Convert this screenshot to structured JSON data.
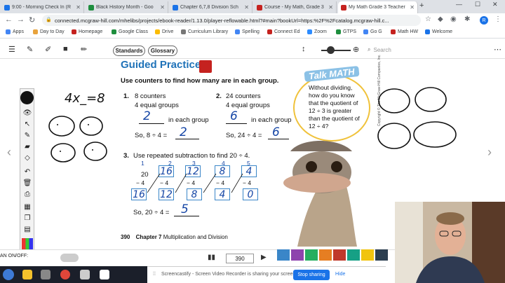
{
  "browser": {
    "tabs": [
      {
        "label": "9:00 - Morning Check In (R",
        "color": "#1a73e8",
        "active": false
      },
      {
        "label": "Black History Month - Goo",
        "color": "#1e8e3e",
        "active": false
      },
      {
        "label": "Chapter 6,7,8 Division Sch",
        "color": "#1a73e8",
        "active": false
      },
      {
        "label": "Course - My Math, Grade 3",
        "color": "#c5221f",
        "active": false
      },
      {
        "label": "My Math Grade 3 Teacher",
        "color": "#c5221f",
        "active": true
      }
    ],
    "url": "connected.mcgraw-hill.com/mhelibs/projects/ebook-reader/1.13.0/player-reflowable.html?#main?bookUrl=https:%2F%2Fcatalog.mcgraw-hill.c...",
    "profile_initial": "R",
    "bookmarks": [
      {
        "label": "Apps",
        "color": "#4285f4"
      },
      {
        "label": "Day to Day",
        "color": "#e8a33d"
      },
      {
        "label": "Homepage",
        "color": "#c5221f"
      },
      {
        "label": "Google Class",
        "color": "#1e8e3e"
      },
      {
        "label": "Drive",
        "color": "#fbbc04"
      },
      {
        "label": "Curriculum Library",
        "color": "#777777"
      },
      {
        "label": "Spelling",
        "color": "#4285f4"
      },
      {
        "label": "Connect Ed",
        "color": "#c5221f"
      },
      {
        "label": "Zoom",
        "color": "#2d8cff"
      },
      {
        "label": "GTPS",
        "color": "#1e8e3e"
      },
      {
        "label": "Go G",
        "color": "#4285f4"
      },
      {
        "label": "Math HW",
        "color": "#c5221f"
      },
      {
        "label": "Welcome",
        "color": "#1a73e8"
      }
    ]
  },
  "reader": {
    "standards_label": "Standards",
    "glossary_label": "Glossary",
    "search_placeholder": "Search",
    "page_number": "390",
    "onoff_label": "AN        ON/OFF:"
  },
  "page": {
    "heading": "Guided Practice",
    "instruction": "Use counters to find how many are in each group.",
    "problem1": {
      "number": "1.",
      "line1": "8 counters",
      "line2": "4 equal groups",
      "answer": "2",
      "suffix": "in each group",
      "eq_prefix": "So, 8 ÷ 4 =",
      "eq_answer": "2"
    },
    "problem2": {
      "number": "2.",
      "line1": "24 counters",
      "line2": "4 equal groups",
      "answer": "6",
      "suffix": "in each group",
      "eq_prefix": "So, 24 ÷ 4 =",
      "eq_answer": "6"
    },
    "problem3": {
      "number": "3.",
      "text": "Use repeated subtraction to find 20 ÷ 4.",
      "start": "20",
      "minus": "− 4",
      "results": [
        "16",
        "12",
        "8",
        "4",
        "0"
      ],
      "counts": [
        "1",
        "2",
        "3",
        "4",
        "5"
      ],
      "top_boxes": [
        "16",
        "12",
        "8",
        "4"
      ],
      "eq_prefix": "So, 20 ÷ 4 =",
      "eq_answer": "5"
    },
    "talk_math": {
      "label": "Talk MATH",
      "text": "Without dividing, how do you know that the quotient of 12 ÷ 3 is greater than the quotient of 12 ÷ 4?"
    },
    "footer_page": "390",
    "footer_chapter": "Chapter 7",
    "footer_title": "Multiplication and Division",
    "copyright": "Copyright © The McGraw-Hill Companies, Inc."
  },
  "annotations": {
    "scribble": "4x_=8"
  },
  "screencastify": {
    "message": "Screencastify - Screen Video Recorder is sharing your screen.",
    "stop_label": "Stop sharing",
    "hide_label": "Hide"
  }
}
